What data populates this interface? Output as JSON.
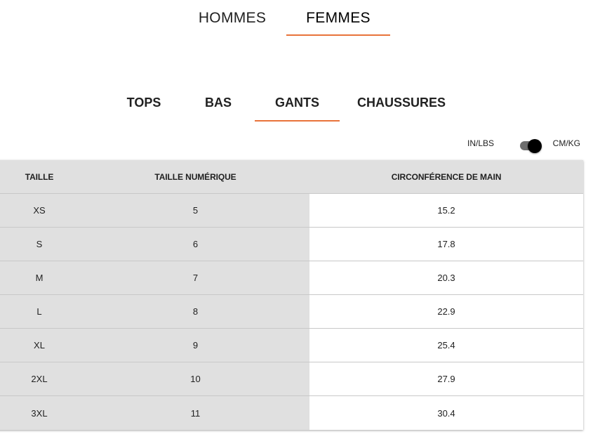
{
  "gender_tabs": [
    {
      "label": "HOMMES",
      "active": false
    },
    {
      "label": "FEMMES",
      "active": true
    }
  ],
  "category_tabs": [
    {
      "label": "TOPS",
      "active": false
    },
    {
      "label": "BAS",
      "active": false
    },
    {
      "label": "GANTS",
      "active": true
    },
    {
      "label": "CHAUSSURES",
      "active": false
    }
  ],
  "unit_toggle": {
    "left_label": "IN/LBS",
    "right_label": "CM/KG",
    "selected": "CM/KG"
  },
  "accent_color": "#e8733a",
  "table": {
    "headers": [
      "TAILLE",
      "TAILLE NUMÉRIQUE",
      "CIRCONFÉRENCE DE MAIN"
    ],
    "rows": [
      [
        "XS",
        "5",
        "15.2"
      ],
      [
        "S",
        "6",
        "17.8"
      ],
      [
        "M",
        "7",
        "20.3"
      ],
      [
        "L",
        "8",
        "22.9"
      ],
      [
        "XL",
        "9",
        "25.4"
      ],
      [
        "2XL",
        "10",
        "27.9"
      ],
      [
        "3XL",
        "11",
        "30.4"
      ]
    ]
  }
}
